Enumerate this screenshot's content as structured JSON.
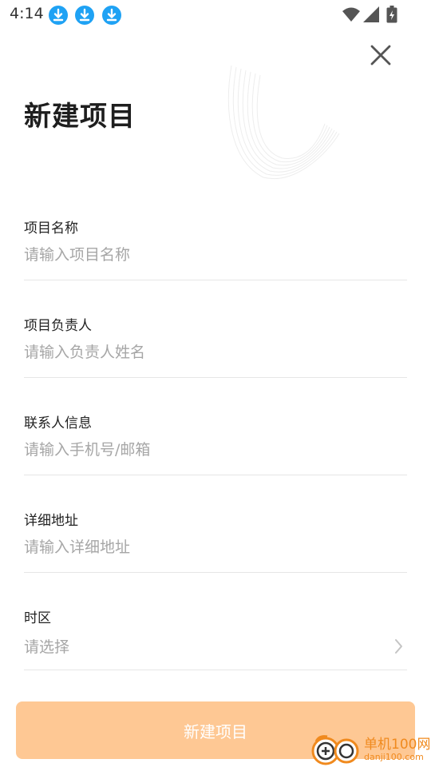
{
  "status_bar": {
    "time": "4:14",
    "notification_icons": [
      "download-icon",
      "download-icon",
      "download-icon"
    ],
    "system_icons": [
      "wifi-icon",
      "signal-icon",
      "battery-charging-icon"
    ]
  },
  "header": {
    "title": "新建项目",
    "close_icon": "close-icon"
  },
  "form": {
    "project_name": {
      "label": "项目名称",
      "placeholder": "请输入项目名称"
    },
    "owner": {
      "label": "项目负责人",
      "placeholder": "请输入负责人姓名"
    },
    "contact": {
      "label": "联系人信息",
      "placeholder": "请输入手机号/邮箱"
    },
    "address": {
      "label": "详细地址",
      "placeholder": "请输入详细地址"
    },
    "timezone": {
      "label": "时区",
      "placeholder": "请选择",
      "icon": "chevron-right-icon"
    }
  },
  "submit": {
    "label": "新建项目"
  },
  "watermark": {
    "cn": "单机100网",
    "en": "danji100.com"
  },
  "colors": {
    "accent_button": "#fec894",
    "download_badge": "#1fa2f4",
    "placeholder": "#a6a6a6",
    "divider": "#e6e6e6",
    "watermark": "#f08a1e"
  }
}
